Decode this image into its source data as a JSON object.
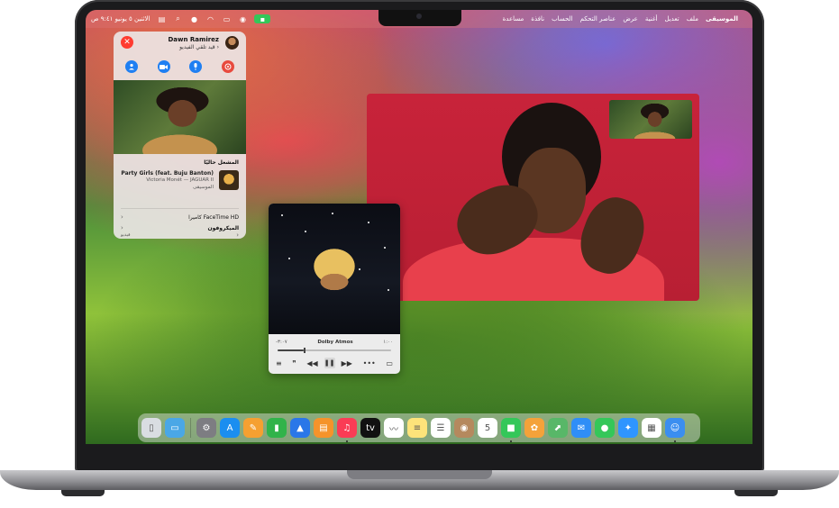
{
  "menubar": {
    "items": [
      "الموسيقى",
      "ملف",
      "تعديل",
      "أغنية",
      "عرض",
      "عناصر التحكم",
      "الحساب",
      "نافذة",
      "مساعدة"
    ],
    "datetime": "الاثنين ٥ يونيو ٩:٤١ ص"
  },
  "facetime_panel": {
    "caller_name": "Dawn Ramirez",
    "caller_status": "قيد تلقي الفيديو ›",
    "section_title": "المشغل حاليًا",
    "now_playing": {
      "title": "Party Girls (feat. Buju Banton)",
      "artist": "Victoria Monét — JAGUAR II",
      "album": "الموسيقى"
    },
    "rows": [
      {
        "label": "كاميرا FaceTime HD",
        "chevron": "›"
      },
      {
        "label": "الميكروفون",
        "chevron": "›"
      },
      {
        "label": "فيديو",
        "chevron": "›"
      }
    ]
  },
  "music_player": {
    "time_elapsed": "١:٠٠",
    "time_remaining": "-٣:٠٧",
    "badge": "Dolby Atmos",
    "progress": 0.23
  },
  "dock": {
    "apps": [
      {
        "name": "finder-icon",
        "color": "#3b8ef0",
        "glyph": "☺",
        "running": true
      },
      {
        "name": "launchpad-icon",
        "color": "#ffffff",
        "glyph": "▦",
        "running": false
      },
      {
        "name": "safari-icon",
        "color": "#2f95ff",
        "glyph": "✦",
        "running": false
      },
      {
        "name": "messages-icon",
        "color": "#34c759",
        "glyph": "●",
        "running": false
      },
      {
        "name": "mail-icon",
        "color": "#2f8ef7",
        "glyph": "✉",
        "running": false
      },
      {
        "name": "maps-icon",
        "color": "#58b768",
        "glyph": "⬈",
        "running": false
      },
      {
        "name": "photos-icon",
        "color": "#f4a23a",
        "glyph": "✿",
        "running": false
      },
      {
        "name": "facetime-icon",
        "color": "#34c759",
        "glyph": "■",
        "running": true
      },
      {
        "name": "calendar-icon",
        "color": "#ffffff",
        "glyph": "5",
        "running": false
      },
      {
        "name": "contacts-icon",
        "color": "#b5895e",
        "glyph": "◉",
        "running": false
      },
      {
        "name": "reminders-icon",
        "color": "#ffffff",
        "glyph": "☰",
        "running": false
      },
      {
        "name": "notes-icon",
        "color": "#fde37a",
        "glyph": "≡",
        "running": false
      },
      {
        "name": "freeform-icon",
        "color": "#ffffff",
        "glyph": "〰",
        "running": false
      },
      {
        "name": "tv-icon",
        "color": "#111111",
        "glyph": "tv",
        "running": false
      },
      {
        "name": "music-icon",
        "color": "#fa3c55",
        "glyph": "♫",
        "running": true
      },
      {
        "name": "books-icon",
        "color": "#f5932a",
        "glyph": "▤",
        "running": false
      },
      {
        "name": "keynote-icon",
        "color": "#2a77e8",
        "glyph": "▲",
        "running": false
      },
      {
        "name": "numbers-icon",
        "color": "#31b34a",
        "glyph": "▮",
        "running": false
      },
      {
        "name": "pages-icon",
        "color": "#f5a031",
        "glyph": "✎",
        "running": false
      },
      {
        "name": "app-store-icon",
        "color": "#1b8ef0",
        "glyph": "A",
        "running": false
      },
      {
        "name": "system-settings-icon",
        "color": "#7d7d82",
        "glyph": "⚙",
        "running": false
      }
    ],
    "trailing": [
      {
        "name": "downloads-folder-icon",
        "color": "#4aa7e6",
        "glyph": "▭"
      },
      {
        "name": "trash-icon",
        "color": "#d9dde2",
        "glyph": "▯"
      }
    ]
  }
}
